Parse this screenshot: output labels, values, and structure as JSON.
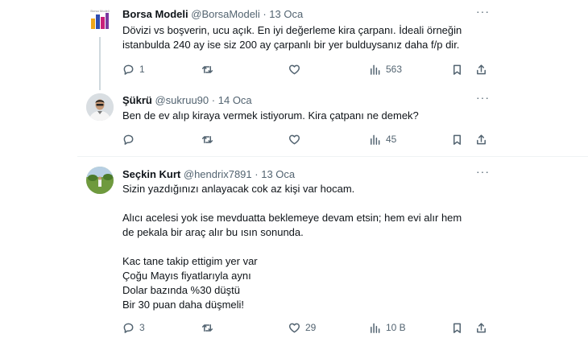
{
  "tweets": [
    {
      "name": "Borsa Modeli",
      "handle": "@BorsaModeli",
      "sep": "·",
      "date": "13 Oca",
      "lines": [
        "Dövizi vs boşverin, ucu açık. En iyi değerleme kira çarpanı. İdeali örneğin",
        "istanbulda 240 ay ise siz 200 ay çarpanlı bir yer bulduysanız daha f/p dir."
      ],
      "replies": "1",
      "retweets": "",
      "likes": "",
      "views": "563"
    },
    {
      "name": "Şükrü",
      "handle": "@sukruu90",
      "sep": "·",
      "date": "14 Oca",
      "lines": [
        "Ben de ev alıp kiraya vermek istiyorum. Kira çatpanı ne demek?"
      ],
      "replies": "",
      "retweets": "",
      "likes": "",
      "views": "45"
    },
    {
      "name": "Seçkin Kurt",
      "handle": "@hendrix7891",
      "sep": "·",
      "date": "13 Oca",
      "paragraphs": [
        [
          "Sizin yazdığınızı anlayacak cok az kişi var hocam."
        ],
        [
          "Alıcı acelesi yok ise mevduatta beklemeye devam etsin; hem evi alır hem",
          "de pekala bir araç alır bu ısın sonunda."
        ],
        [
          "Kac tane takip ettigim yer var",
          "Çoğu Mayıs fiyatlarıyla aynı",
          "Dolar bazında %30 düştü",
          "Bir 30 puan daha düşmeli!"
        ]
      ],
      "replies": "3",
      "retweets": "",
      "likes": "29",
      "views": "10 B"
    }
  ],
  "avatar_logo_text": "Borsa Modeli",
  "icons": {
    "more": "more-icon",
    "reply": "reply-icon",
    "retweet": "retweet-icon",
    "like": "like-icon",
    "views": "views-icon",
    "bookmark": "bookmark-icon",
    "share": "share-icon"
  },
  "colors": {
    "text": "#0f1419",
    "secondary": "#536471",
    "line": "#cfd9de",
    "divider": "#eff3f4"
  }
}
